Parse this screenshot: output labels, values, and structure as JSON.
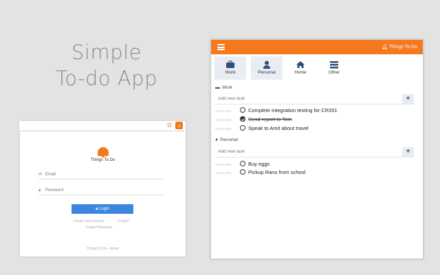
{
  "hero": {
    "line1": "Simple",
    "line2": "To-do App"
  },
  "browser": {
    "star": "☆"
  },
  "login": {
    "brand": "Things To Do",
    "email_label": "Email",
    "password_label": "Password",
    "login_button": "Login",
    "link_left": "Create new account",
    "link_right": "Forgot?",
    "link_below": "Forgot Password",
    "footer": "Things To Do · About"
  },
  "app": {
    "brand": "Things To Do",
    "accent": "#f47a1d",
    "tabs": [
      {
        "label": "Work",
        "icon": "briefcase-icon"
      },
      {
        "label": "Personal",
        "icon": "person-icon"
      },
      {
        "label": "Home",
        "icon": "home-icon"
      },
      {
        "label": "Other",
        "icon": "list-icon"
      }
    ],
    "sections": [
      {
        "title": "Work",
        "placeholder": "Add new task",
        "tasks": [
          {
            "date": "04-Apr-2019",
            "text": "Complete integration testing for CR201",
            "done": false
          },
          {
            "date": "04-Apr-2019",
            "text": "Send report to Tom",
            "done": true
          },
          {
            "date": "04-Apr-2019",
            "text": "Speak to Amit about travel",
            "done": false
          }
        ]
      },
      {
        "title": "Personal",
        "placeholder": "Add new task",
        "tasks": [
          {
            "date": "04-Apr-2019",
            "text": "Buy eggs",
            "done": false
          },
          {
            "date": "04-Apr-2019",
            "text": "Pickup Ranu from school",
            "done": false
          }
        ]
      }
    ]
  }
}
